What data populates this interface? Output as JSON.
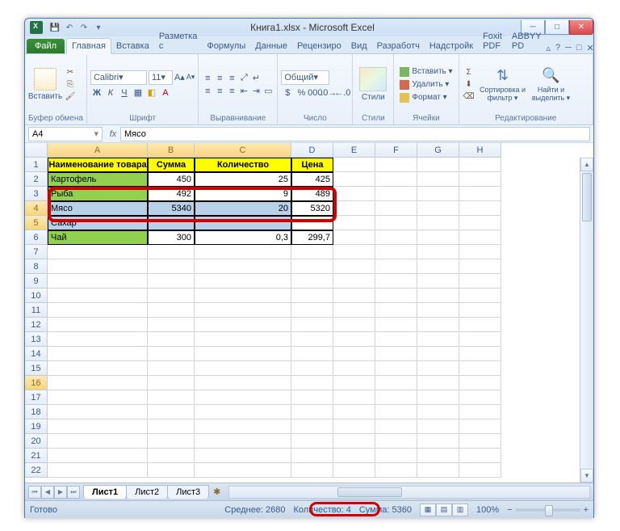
{
  "window": {
    "title": "Книга1.xlsx - Microsoft Excel"
  },
  "qat": {
    "save": "💾",
    "undo": "↶",
    "redo": "↷",
    "more": "▾"
  },
  "tabs": {
    "file": "Файл",
    "items": [
      "Главная",
      "Вставка",
      "Разметка с",
      "Формулы",
      "Данные",
      "Рецензиро",
      "Вид",
      "Разработч",
      "Надстройк",
      "Foxit PDF",
      "ABBYY PD"
    ],
    "active": 0,
    "help": "?"
  },
  "ribbon": {
    "clipboard": {
      "paste": "Вставить",
      "label": "Буфер обмена"
    },
    "font": {
      "name": "Calibri",
      "size": "11",
      "label": "Шрифт"
    },
    "align": {
      "label": "Выравнивание"
    },
    "number": {
      "format": "Общий",
      "label": "Число"
    },
    "styles": {
      "btn": "Стили",
      "label": "Стили"
    },
    "cells": {
      "insert": "Вставить ▾",
      "delete": "Удалить ▾",
      "format": "Формат ▾",
      "label": "Ячейки"
    },
    "editing": {
      "sort": "Сортировка и фильтр ▾",
      "find": "Найти и выделить ▾",
      "label": "Редактирование"
    }
  },
  "fx": {
    "name": "A4",
    "value": "Мясо",
    "fx": "fx"
  },
  "grid": {
    "cols": [
      {
        "l": "A",
        "w": 124
      },
      {
        "l": "B",
        "w": 58
      },
      {
        "l": "C",
        "w": 120
      },
      {
        "l": "D",
        "w": 52
      },
      {
        "l": "E",
        "w": 52
      },
      {
        "l": "F",
        "w": 52
      },
      {
        "l": "G",
        "w": 52
      },
      {
        "l": "H",
        "w": 52
      }
    ],
    "headers": [
      "Наименование товара",
      "Сумма",
      "Количество",
      "Цена"
    ],
    "rows": [
      {
        "n": "Картофель",
        "s": "450",
        "k": "25",
        "c": "425"
      },
      {
        "n": "Рыба",
        "s": "492",
        "k": "9",
        "c": "489"
      },
      {
        "n": "Мясо",
        "s": "5340",
        "k": "20",
        "c": "5320"
      },
      {
        "n": "Сахар",
        "s": "",
        "k": "",
        "c": ""
      },
      {
        "n": "Чай",
        "s": "300",
        "k": "0,3",
        "c": "299,7"
      }
    ],
    "visible_rows": 22,
    "selected_rows": [
      4,
      5
    ],
    "active_row": 4,
    "yellow_row": 16
  },
  "sheets": {
    "tabs": [
      "Лист1",
      "Лист2",
      "Лист3"
    ],
    "active": 0
  },
  "status": {
    "ready": "Готово",
    "avg": "Среднее: 2680",
    "count": "Количество: 4",
    "sum": "Сумма: 5360",
    "zoom": "100%"
  }
}
